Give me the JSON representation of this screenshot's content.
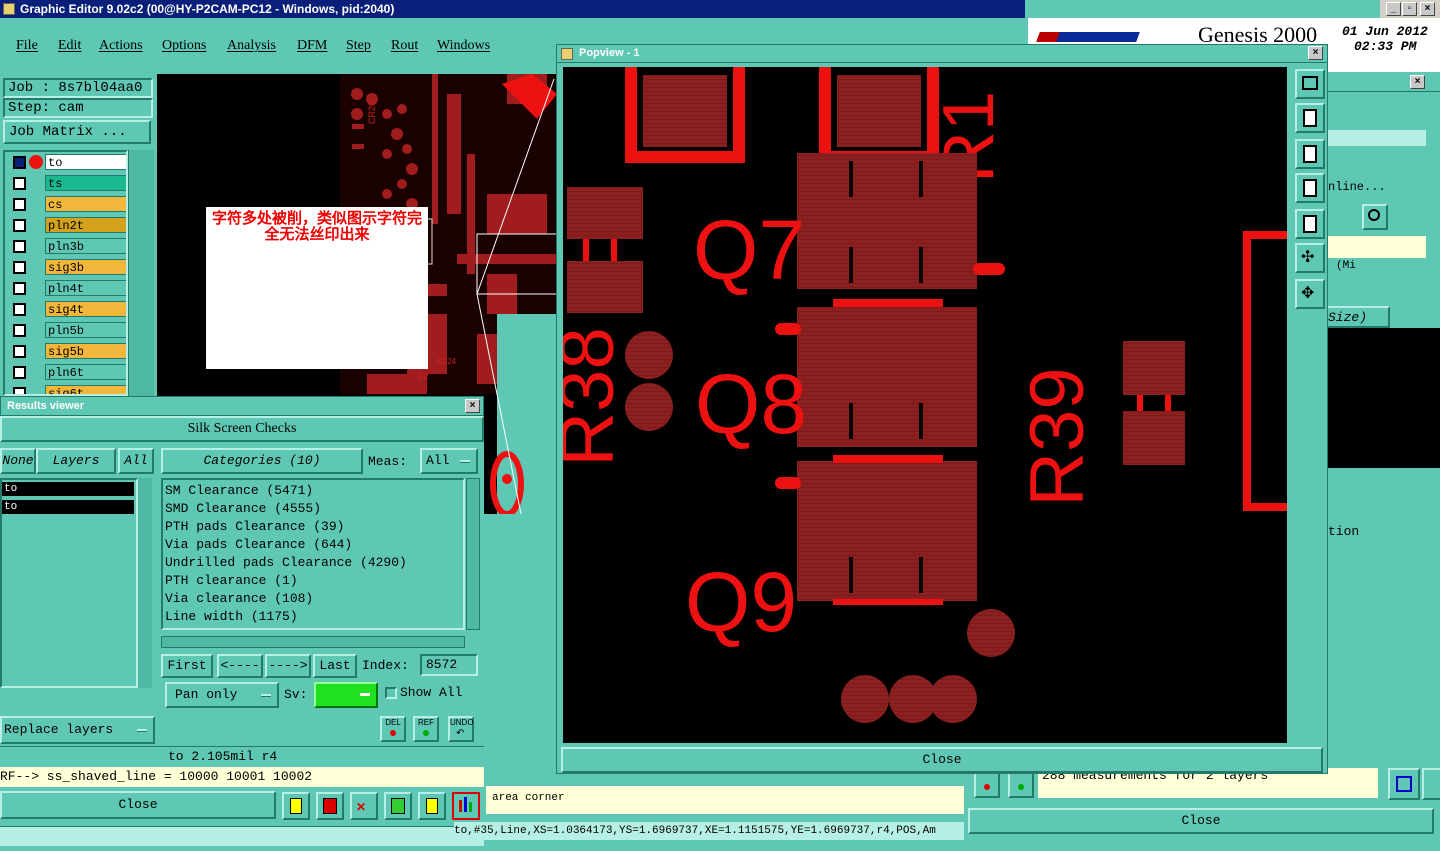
{
  "window": {
    "title": "Graphic Editor 9.02c2 (00@HY-P2CAM-PC12 - Windows, pid:2040)"
  },
  "menu": [
    "File",
    "Edit",
    "Actions",
    "Options",
    "Analysis",
    "DFM",
    "Step",
    "Rout",
    "Windows"
  ],
  "genesis": {
    "brand": "Genesis 2000",
    "date": "01 Jun 2012",
    "time": "02:33 PM"
  },
  "job": {
    "job_label": "Job : 8s7bl04aa0",
    "step_label": "Step: cam",
    "matrix_button": "Job Matrix ..."
  },
  "layers": [
    {
      "name": "to",
      "color": "#ffffff"
    },
    {
      "name": "ts",
      "color": "#19b88f"
    },
    {
      "name": "cs",
      "color": "#f2b63a"
    },
    {
      "name": "pln2t",
      "color": "#d4a21a"
    },
    {
      "name": "pln3b",
      "color": "#5fc8b4"
    },
    {
      "name": "sig3b",
      "color": "#f2b63a"
    },
    {
      "name": "pln4t",
      "color": "#5fc8b4"
    },
    {
      "name": "sig4t",
      "color": "#f2b63a"
    },
    {
      "name": "pln5b",
      "color": "#5fc8b4"
    },
    {
      "name": "sig5b",
      "color": "#f2b63a"
    },
    {
      "name": "pln6t",
      "color": "#5fc8b4"
    },
    {
      "name": "sig6t",
      "color": "#f2b63a"
    }
  ],
  "note": {
    "text": "字符多处被削，类似图示字符完全无法丝印出来"
  },
  "results_viewer": {
    "title": "Results viewer",
    "heading": "Silk Screen Checks",
    "none_tab": "None",
    "layers_tab": "Layers",
    "all_tab": "All",
    "categories_label": "Categories (10)",
    "meas_label": "Meas:",
    "meas_value": "All",
    "layer_list": [
      "to",
      "to"
    ],
    "categories": [
      "SM Clearance (5471)",
      "SMD Clearance (4555)",
      "PTH pads Clearance (39)",
      "Via pads Clearance (644)",
      "Undrilled pads Clearance (4290)",
      "PTH clearance (1)",
      "Via clearance (108)",
      "Line width (1175)"
    ],
    "nav": {
      "first": "First",
      "prev": "<----",
      "next": "---->",
      "last": "Last",
      "index_label": "Index:",
      "index_value": "8572"
    },
    "pan_mode": "Pan only",
    "sv_label": "Sv:",
    "show_all": "Show All",
    "replace_layers": "Replace layers",
    "del": "DEL",
    "ref": "REF",
    "undo": "UNDO",
    "measure_line": "to 2.105mil  r4",
    "ref_line": "RF--> ss_shaved_line = 10000 10001 10002",
    "close": "Close"
  },
  "popview": {
    "title": "Popview - 1",
    "close": "Close",
    "labels": {
      "q7": "Q7",
      "q8": "Q8",
      "q9": "Q9",
      "r38": "R38",
      "r39": "R39",
      "r1": "R1"
    }
  },
  "right_panel": {
    "online": "nline...",
    "size": "Size)",
    "tion": "tion",
    "mi": "(Mi",
    "measurements": "288 measurements for 2 layers",
    "close": "Close"
  },
  "status": {
    "mode": "area corner",
    "coords": "to,#35,Line,XS=1.0364173,YS=1.6969737,XE=1.1151575,YE=1.6969737,r4,POS,Am"
  }
}
